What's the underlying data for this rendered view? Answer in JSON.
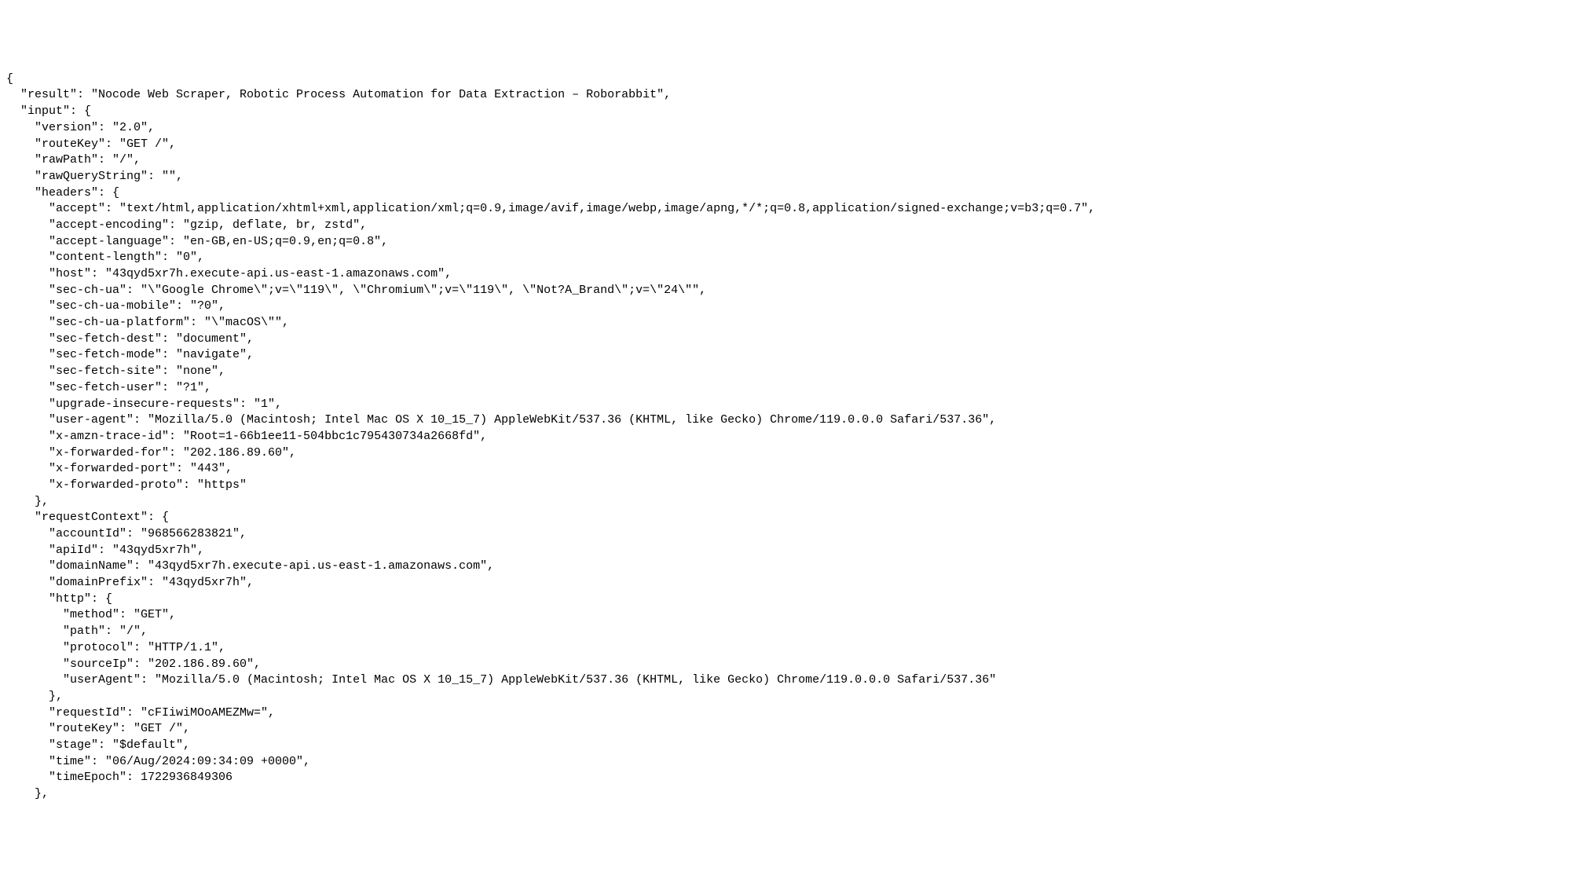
{
  "json_lines": [
    "{",
    "  \"result\": \"Nocode Web Scraper, Robotic Process Automation for Data Extraction – Roborabbit\",",
    "  \"input\": {",
    "    \"version\": \"2.0\",",
    "    \"routeKey\": \"GET /\",",
    "    \"rawPath\": \"/\",",
    "    \"rawQueryString\": \"\",",
    "    \"headers\": {",
    "      \"accept\": \"text/html,application/xhtml+xml,application/xml;q=0.9,image/avif,image/webp,image/apng,*/*;q=0.8,application/signed-exchange;v=b3;q=0.7\",",
    "      \"accept-encoding\": \"gzip, deflate, br, zstd\",",
    "      \"accept-language\": \"en-GB,en-US;q=0.9,en;q=0.8\",",
    "      \"content-length\": \"0\",",
    "      \"host\": \"43qyd5xr7h.execute-api.us-east-1.amazonaws.com\",",
    "      \"sec-ch-ua\": \"\\\"Google Chrome\\\";v=\\\"119\\\", \\\"Chromium\\\";v=\\\"119\\\", \\\"Not?A_Brand\\\";v=\\\"24\\\"\",",
    "      \"sec-ch-ua-mobile\": \"?0\",",
    "      \"sec-ch-ua-platform\": \"\\\"macOS\\\"\",",
    "      \"sec-fetch-dest\": \"document\",",
    "      \"sec-fetch-mode\": \"navigate\",",
    "      \"sec-fetch-site\": \"none\",",
    "      \"sec-fetch-user\": \"?1\",",
    "      \"upgrade-insecure-requests\": \"1\",",
    "      \"user-agent\": \"Mozilla/5.0 (Macintosh; Intel Mac OS X 10_15_7) AppleWebKit/537.36 (KHTML, like Gecko) Chrome/119.0.0.0 Safari/537.36\",",
    "      \"x-amzn-trace-id\": \"Root=1-66b1ee11-504bbc1c795430734a2668fd\",",
    "      \"x-forwarded-for\": \"202.186.89.60\",",
    "      \"x-forwarded-port\": \"443\",",
    "      \"x-forwarded-proto\": \"https\"",
    "    },",
    "    \"requestContext\": {",
    "      \"accountId\": \"968566283821\",",
    "      \"apiId\": \"43qyd5xr7h\",",
    "      \"domainName\": \"43qyd5xr7h.execute-api.us-east-1.amazonaws.com\",",
    "      \"domainPrefix\": \"43qyd5xr7h\",",
    "      \"http\": {",
    "        \"method\": \"GET\",",
    "        \"path\": \"/\",",
    "        \"protocol\": \"HTTP/1.1\",",
    "        \"sourceIp\": \"202.186.89.60\",",
    "        \"userAgent\": \"Mozilla/5.0 (Macintosh; Intel Mac OS X 10_15_7) AppleWebKit/537.36 (KHTML, like Gecko) Chrome/119.0.0.0 Safari/537.36\"",
    "      },",
    "      \"requestId\": \"cFIiwiMOoAMEZMw=\",",
    "      \"routeKey\": \"GET /\",",
    "      \"stage\": \"$default\",",
    "      \"time\": \"06/Aug/2024:09:34:09 +0000\",",
    "      \"timeEpoch\": 1722936849306",
    "    },"
  ]
}
